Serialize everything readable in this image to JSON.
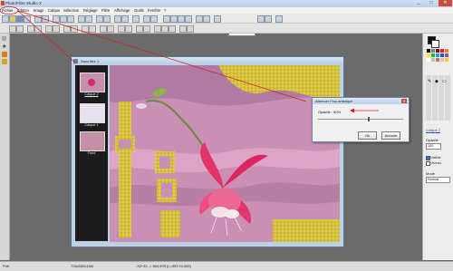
{
  "window": {
    "title": "PhotoFiltre Studio X",
    "controls": [
      "_",
      "□",
      "✕"
    ]
  },
  "menu": [
    "Fichier",
    "Edition",
    "Image",
    "Calque",
    "Sélection",
    "Réglage",
    "Filtre",
    "Affichage",
    "Outils",
    "Fenêtre",
    "?"
  ],
  "toolbar": {
    "zoom_value": "100%"
  },
  "document": {
    "title": "Sans titre 1",
    "layers": [
      {
        "label": "Calque 2"
      },
      {
        "label": "Calque 1"
      },
      {
        "label": "Fond"
      }
    ]
  },
  "dialog": {
    "title": "Atténuer Flou artistique",
    "opacity_label": "Opacité : 60%",
    "opacity_value": 60,
    "ok_label": "Ok",
    "cancel_label": "Annuler"
  },
  "panel": {
    "layer_name": "Calque 2",
    "opacity_label": "Opacité",
    "opacity_value": "100",
    "visible_label": "Visible",
    "lock_label": "Verrou",
    "mode_label": "Mode",
    "mode_value": "Normal"
  },
  "status": {
    "ready": "Prêt",
    "size": "706x550x16M",
    "coords": "-32+45 -> 563;499 (L=353  H=345)"
  },
  "colors": {
    "annotation": "#d42020",
    "accent": "#3c6bd6"
  }
}
